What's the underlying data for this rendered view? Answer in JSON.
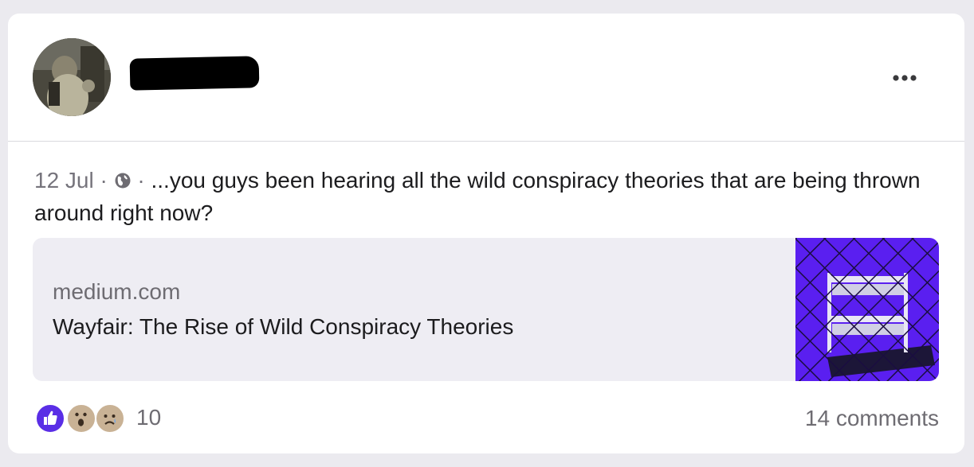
{
  "post": {
    "date": "12 Jul",
    "separator": "·",
    "visibility_icon": "globe-icon",
    "text": "...you guys been hearing all the wild conspiracy theories that are being thrown around right now?"
  },
  "link_preview": {
    "domain": "medium.com",
    "title": "Wayfair: The Rise of Wild Conspiracy Theories"
  },
  "footer": {
    "reaction_icons": [
      "like-icon",
      "wow-icon",
      "sad-icon"
    ],
    "reaction_count": "10",
    "comments_label": "14 comments"
  },
  "colors": {
    "like": "#5a2ee6",
    "thumbnail": "#5a1ff0",
    "meta_text": "#76747c"
  }
}
